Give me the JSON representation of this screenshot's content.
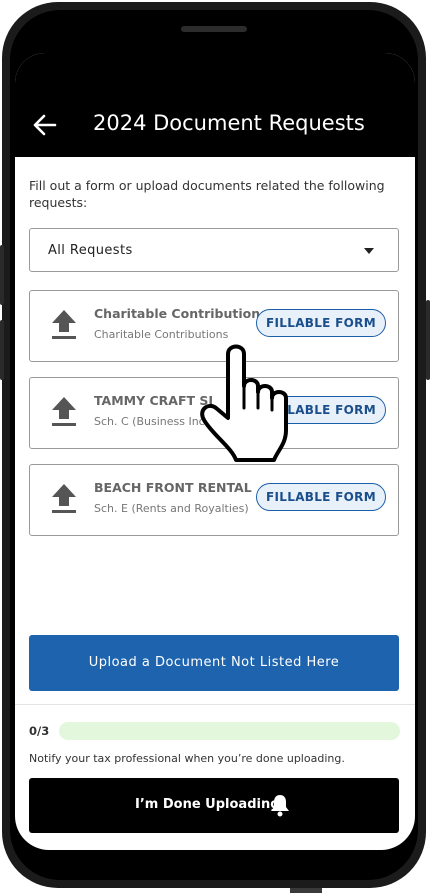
{
  "header": {
    "title": "2024 Document Requests"
  },
  "intro_text": "Fill out a form or upload documents related the following requests:",
  "filter": {
    "selected": "All Requests"
  },
  "requests": [
    {
      "name": "Charitable Contributions",
      "sub": "Charitable Contributions",
      "action": "FILLABLE FORM"
    },
    {
      "name": "TAMMY CRAFT SE",
      "sub": "Sch. C (Business Income",
      "action": "FILLABLE FORM"
    },
    {
      "name": "BEACH FRONT RENTAL ...",
      "sub": "Sch. E (Rents and Royalties)",
      "action": "FILLABLE FORM"
    }
  ],
  "upload_button": "Upload a Document Not Listed Here",
  "progress": {
    "label": "0/3",
    "done": 0,
    "total": 3
  },
  "notify_text": "Notify your tax professional when you’re done uploading.",
  "done_button": "I’m Done Uploading",
  "colors": {
    "primary": "#1e63ae",
    "header_bg": "#000000",
    "progress_track": "#e3f7dd"
  },
  "icons": [
    "back-arrow-icon",
    "chevron-down-icon",
    "upload-icon",
    "bell-icon",
    "hand-pointer-icon"
  ]
}
